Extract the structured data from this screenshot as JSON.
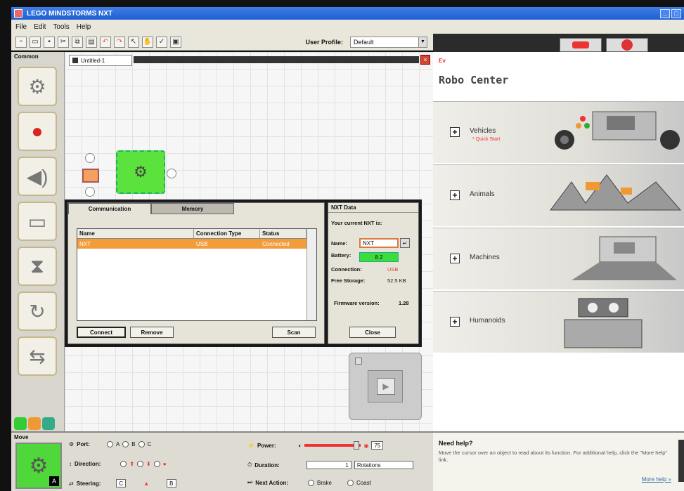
{
  "window": {
    "title": "LEGO MINDSTORMS NXT"
  },
  "menu": [
    "File",
    "Edit",
    "Tools",
    "Help"
  ],
  "toolbar": {
    "icons": [
      "new-icon",
      "open-icon",
      "save-icon",
      "cut-icon",
      "copy-icon",
      "paste-icon",
      "undo-icon",
      "redo-icon",
      "pointer-icon",
      "pan-icon",
      "comment-icon",
      "custom-palette-icon"
    ],
    "profile_label": "User Profile:",
    "profile_value": "Default"
  },
  "palette": {
    "label": "Common",
    "items": [
      {
        "name": "move-block",
        "glyph": "⚙"
      },
      {
        "name": "record-play-block",
        "glyph": "●"
      },
      {
        "name": "sound-block",
        "glyph": "🔊"
      },
      {
        "name": "display-block",
        "glyph": "▭"
      },
      {
        "name": "wait-block",
        "glyph": "⧗"
      },
      {
        "name": "loop-block",
        "glyph": "↻"
      },
      {
        "name": "switch-block",
        "glyph": "⇆"
      }
    ]
  },
  "document": {
    "tab": "Untitled-1"
  },
  "dialog": {
    "tabs": [
      "Communication",
      "Memory"
    ],
    "columns": [
      "Name",
      "Connection Type",
      "Status"
    ],
    "rows": [
      {
        "name": "NXT",
        "connection": "USB",
        "status": "Connected"
      }
    ],
    "buttons": {
      "connect": "Connect",
      "remove": "Remove",
      "scan": "Scan",
      "close": "Close"
    },
    "nxt": {
      "title": "NXT Data",
      "subtitle": "Your current NXT is:",
      "name_label": "Name:",
      "name_value": "NXT",
      "battery_label": "Battery:",
      "battery_value": "8.2",
      "connection_label": "Connection:",
      "connection_value": "USB",
      "storage_label": "Free Storage:",
      "storage_value": "52.5 KB",
      "firmware_label": "Firmware version:",
      "firmware_value": "1.28"
    }
  },
  "robo": {
    "small": "Ev",
    "title": "Robo Center",
    "items": [
      {
        "label": "Vehicles",
        "sub": "* Quick Start"
      },
      {
        "label": "Animals",
        "sub": ""
      },
      {
        "label": "Machines",
        "sub": ""
      },
      {
        "label": "Humanoids",
        "sub": ""
      }
    ]
  },
  "config": {
    "label": "Move",
    "badge": "A",
    "port_label": "Port:",
    "ports": [
      "A",
      "B",
      "C"
    ],
    "direction_label": "Direction:",
    "steering_label": "Steering:",
    "steering_left": "C",
    "steering_right": "B",
    "power_label": "Power:",
    "power_value": "75",
    "duration_label": "Duration:",
    "duration_value": "1",
    "duration_unit": "Rotations",
    "next_action_label": "Next Action:",
    "next_brake": "Brake",
    "next_coast": "Coast"
  },
  "help": {
    "title": "Need help?",
    "text": "Move the cursor over an object to read about its function. For additional help, click the \"More help\" link.",
    "link": "More help »"
  }
}
